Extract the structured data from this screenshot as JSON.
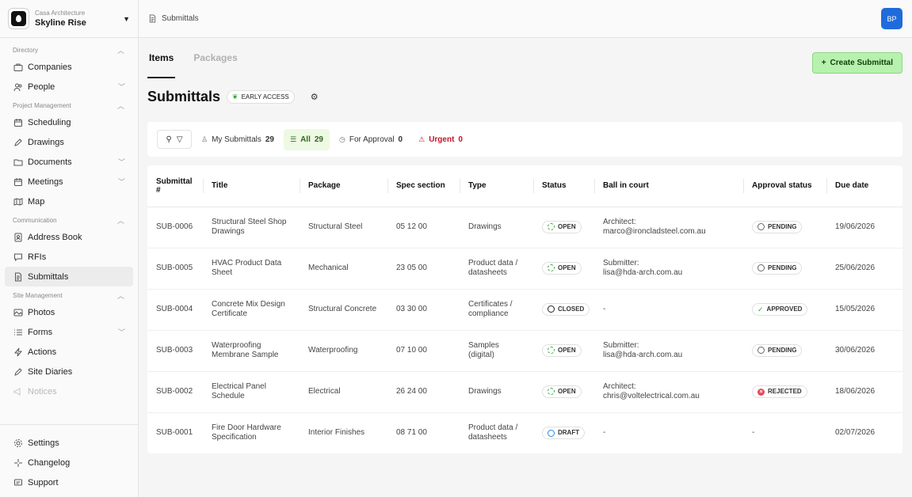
{
  "project": {
    "org": "Casa Architecture",
    "name": "Skyline Rise"
  },
  "sections": {
    "directory": "Directory",
    "project_management": "Project Management",
    "communication": "Communication",
    "site_management": "Site Management"
  },
  "nav": {
    "companies": "Companies",
    "people": "People",
    "scheduling": "Scheduling",
    "drawings": "Drawings",
    "documents": "Documents",
    "meetings": "Meetings",
    "map": "Map",
    "address_book": "Address Book",
    "rfis": "RFIs",
    "submittals": "Submittals",
    "photos": "Photos",
    "forms": "Forms",
    "actions": "Actions",
    "site_diaries": "Site Diaries",
    "notices": "Notices",
    "settings": "Settings",
    "changelog": "Changelog",
    "support": "Support"
  },
  "breadcrumb": "Submittals",
  "avatar": "BP",
  "tabs": {
    "items": "Items",
    "packages": "Packages"
  },
  "create_button": "Create Submittal",
  "page_title": "Submittals",
  "early_access": "EARLY ACCESS",
  "filters": {
    "my": {
      "label": "My Submittals",
      "count": "29"
    },
    "all": {
      "label": "All",
      "count": "29"
    },
    "approval": {
      "label": "For Approval",
      "count": "0"
    },
    "urgent": {
      "label": "Urgent",
      "count": "0"
    }
  },
  "columns": {
    "num": "Submittal #",
    "title": "Title",
    "package": "Package",
    "spec": "Spec section",
    "type": "Type",
    "status": "Status",
    "ball": "Ball in court",
    "approval": "Approval status",
    "due": "Due date"
  },
  "rows": [
    {
      "num": "SUB-0006",
      "title": "Structural Steel Shop Drawings",
      "package": "Structural Steel",
      "spec": "05 12 00",
      "type": "Drawings",
      "status": "OPEN",
      "ball_role": "Architect:",
      "ball_email": "marco@ironcladsteel.com.au",
      "approval": "PENDING",
      "due": "19/06/2026"
    },
    {
      "num": "SUB-0005",
      "title": "HVAC Product Data Sheet",
      "package": "Mechanical",
      "spec": "23 05 00",
      "type": "Product data / datasheets",
      "status": "OPEN",
      "ball_role": "Submitter:",
      "ball_email": "lisa@hda-arch.com.au",
      "approval": "PENDING",
      "due": "25/06/2026"
    },
    {
      "num": "SUB-0004",
      "title": "Concrete Mix Design Certificate",
      "package": "Structural Concrete",
      "spec": "03 30 00",
      "type": "Certificates / compliance",
      "status": "CLOSED",
      "ball_role": "-",
      "ball_email": "",
      "approval": "APPROVED",
      "due": "15/05/2026"
    },
    {
      "num": "SUB-0003",
      "title": "Waterproofing Membrane Sample",
      "package": "Waterproofing",
      "spec": "07 10 00",
      "type": "Samples (digital)",
      "status": "OPEN",
      "ball_role": "Submitter:",
      "ball_email": "lisa@hda-arch.com.au",
      "approval": "PENDING",
      "due": "30/06/2026"
    },
    {
      "num": "SUB-0002",
      "title": "Electrical Panel Schedule",
      "package": "Electrical",
      "spec": "26 24 00",
      "type": "Drawings",
      "status": "OPEN",
      "ball_role": "Architect:",
      "ball_email": "chris@voltelectrical.com.au",
      "approval": "REJECTED",
      "due": "18/06/2026"
    },
    {
      "num": "SUB-0001",
      "title": "Fire Door Hardware Specification",
      "package": "Interior Finishes",
      "spec": "08 71 00",
      "type": "Product data / datasheets",
      "status": "DRAFT",
      "ball_role": "-",
      "ball_email": "",
      "approval": "-",
      "due": "02/07/2026"
    }
  ],
  "colors": {
    "accent_green": "#b6f2ad",
    "avatar_blue": "#1f6bdc",
    "urgent_red": "#c2162d"
  }
}
